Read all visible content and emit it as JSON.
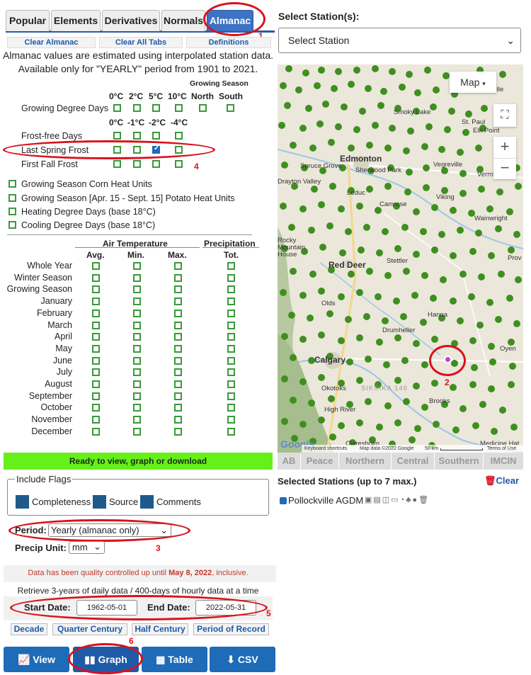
{
  "tabs": [
    "Popular",
    "Elements",
    "Derivatives",
    "Normals",
    "Almanac"
  ],
  "subbuttons": {
    "clear_almanac": "Clear Almanac",
    "clear_all": "Clear All Tabs",
    "definitions": "Definitions"
  },
  "notice": {
    "line1": "Almanac values are estimated using interpolated station data.",
    "line2": "Available only for \"YEARLY\" period from 1901 to 2021."
  },
  "growing": {
    "header": "Growing Season",
    "cols1": [
      "0°C",
      "2°C",
      "5°C",
      "10°C",
      "North",
      "South"
    ],
    "gdd_label": "Growing Degree Days",
    "cols2": [
      "0°C",
      "-1°C",
      "-2°C",
      "-4°C"
    ],
    "frost_rows": [
      "Frost-free Days",
      "Last Spring Frost",
      "First Fall Frost"
    ]
  },
  "heat_units": [
    "Growing Season Corn Heat Units",
    "Growing Season [Apr. 15 - Sept. 15] Potato Heat Units",
    "Heating Degree Days (base 18°C)",
    "Cooling Degree Days (base 18°C)"
  ],
  "temp_table": {
    "air_temp": "Air Temperature",
    "precip": "Precipitation",
    "cols": [
      "Avg.",
      "Min.",
      "Max.",
      "Tot."
    ],
    "rows": [
      "Whole Year",
      "Winter Season",
      "Growing Season",
      "January",
      "February",
      "March",
      "April",
      "May",
      "June",
      "July",
      "August",
      "September",
      "October",
      "November",
      "December"
    ]
  },
  "status": "Ready to view, graph or download",
  "flags": {
    "legend": "Include Flags",
    "items": [
      "Completeness",
      "Source",
      "Comments"
    ]
  },
  "period": {
    "label": "Period:",
    "value": "Yearly (almanac only)"
  },
  "precip_unit": {
    "label": "Precip Unit:",
    "value": "mm"
  },
  "qc_note": {
    "prefix": "Data has been quality controlled up until ",
    "date": "May 8, 2022",
    "suffix": ", inclusive."
  },
  "retrieve_note": "Retrieve 3-years of daily data / 400-days of hourly data at a time",
  "dates": {
    "start_label": "Start Date:",
    "start_value": "1962-05-01",
    "end_label": "End Date:",
    "end_value": "2022-05-31"
  },
  "range_buttons": [
    "Decade",
    "Quarter Century",
    "Half Century",
    "Period of Record"
  ],
  "actions": [
    "View",
    "Graph",
    "Table",
    "CSV"
  ],
  "station_select": {
    "label": "Select Station(s):",
    "value": "Select Station"
  },
  "map": {
    "type_button": "Map",
    "towns": [
      "Bonnyville",
      "Smoky Lake",
      "St. Paul",
      "Elk Point",
      "Edmonton",
      "Spruce Grove",
      "Sherwood Park",
      "Vegreville",
      "Drayton Valley",
      "Leduc",
      "Vermilion",
      "Camrose",
      "Viking",
      "Wainwright",
      "Rocky Mountain House",
      "Red Deer",
      "Stettler",
      "Prov",
      "Olds",
      "Hanna",
      "Drumheller",
      "Oyen",
      "Calgary",
      "Okotoks",
      "Brooks",
      "High River",
      "Claresholm",
      "Medicine Hat",
      "SIKSIKA 146"
    ],
    "footer": [
      "Keyboard shortcuts",
      "Map data ©2022 Google",
      "50 km",
      "Terms of Use"
    ],
    "google": "Google"
  },
  "regions": [
    "AB",
    "Peace",
    "Northern",
    "Central",
    "Southern",
    "IMCIN"
  ],
  "selected": {
    "label": "Selected Stations (up to 7 max.)",
    "clear": "Clear",
    "station": "Pollockville AGDM"
  },
  "annotations": [
    "1",
    "2",
    "3",
    "4",
    "5",
    "6"
  ],
  "colors": {
    "accent": "#1e6bb8",
    "annotation": "#d9121b",
    "status_bar": "#66f01a",
    "station_dot": "#3f8f1f"
  }
}
